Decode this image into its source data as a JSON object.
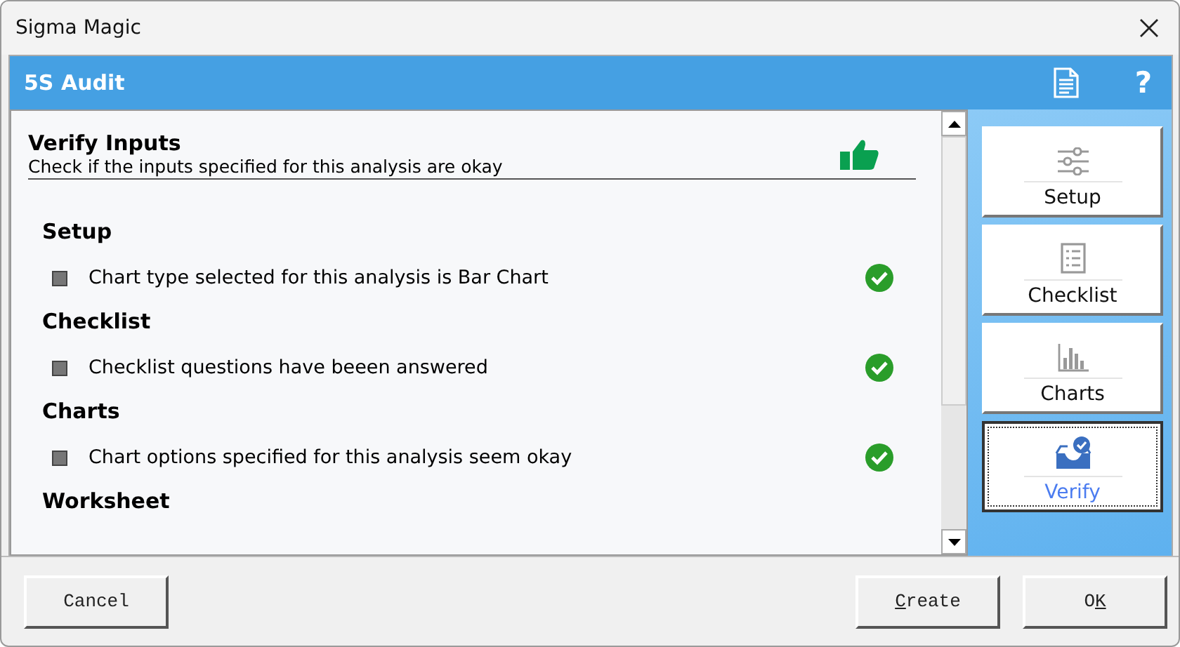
{
  "window": {
    "title": "Sigma Magic"
  },
  "header": {
    "title": "5S Audit",
    "help": "?"
  },
  "panel": {
    "title": "Verify Inputs",
    "subtitle": "Check if the inputs specified for this analysis are okay"
  },
  "sections": [
    {
      "heading": "Setup",
      "items": [
        {
          "text": "Chart type selected for this analysis is Bar Chart",
          "ok": true
        }
      ]
    },
    {
      "heading": "Checklist",
      "items": [
        {
          "text": "Checklist questions have beeen answered",
          "ok": true
        }
      ]
    },
    {
      "heading": "Charts",
      "items": [
        {
          "text": "Chart options specified for this analysis seem okay",
          "ok": true
        }
      ]
    },
    {
      "heading": "Worksheet"
    }
  ],
  "nav": [
    {
      "label": "Setup",
      "kind": "sliders",
      "selected": false
    },
    {
      "label": "Checklist",
      "kind": "checklist",
      "selected": false
    },
    {
      "label": "Charts",
      "kind": "bars",
      "selected": false
    },
    {
      "label": "Verify",
      "kind": "verify",
      "selected": true
    }
  ],
  "left_buttons": [
    {
      "parts": [
        {
          "text": "Cancel",
          "underlined": false
        }
      ]
    }
  ],
  "right_buttons": [
    {
      "parts": [
        {
          "text": "C",
          "underlined": true
        },
        {
          "text": "reate",
          "underlined": false
        }
      ]
    },
    {
      "parts": [
        {
          "text": "O",
          "underlined": false
        },
        {
          "text": "K",
          "underlined": true
        }
      ]
    }
  ]
}
